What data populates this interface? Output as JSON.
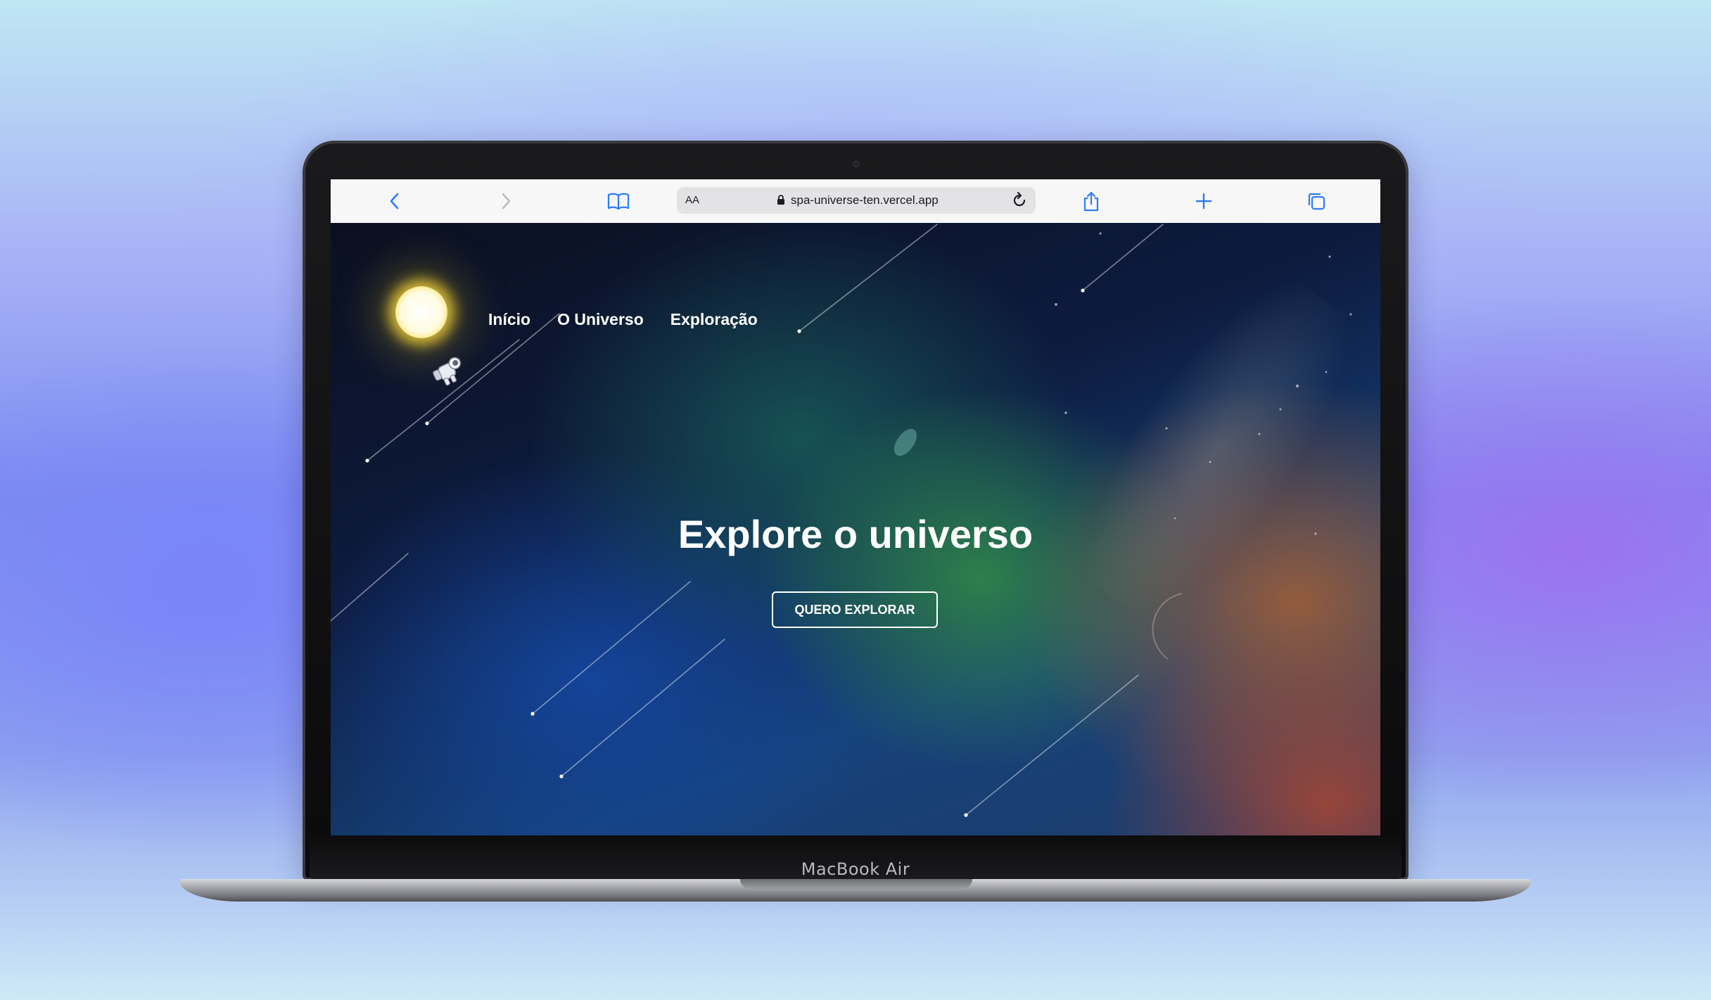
{
  "device": {
    "label": "MacBook Air"
  },
  "browser": {
    "reader_label": "AA",
    "url": "spa-universe-ten.vercel.app",
    "icons": {
      "back": "chevron-left-icon",
      "forward": "chevron-right-icon",
      "bookmarks": "book-icon",
      "lock": "lock-icon",
      "reload": "reload-icon",
      "share": "share-icon",
      "new_tab": "plus-icon",
      "tabs": "tabs-icon"
    },
    "accent_color": "#2f7cf6"
  },
  "site": {
    "nav": [
      {
        "label": "Início"
      },
      {
        "label": "O Universo"
      },
      {
        "label": "Exploração"
      }
    ],
    "hero": {
      "title": "Explore o universo",
      "button_label": "QUERO EXPLORAR"
    },
    "logo": "sun-logo",
    "mascot": "astronaut-icon"
  }
}
